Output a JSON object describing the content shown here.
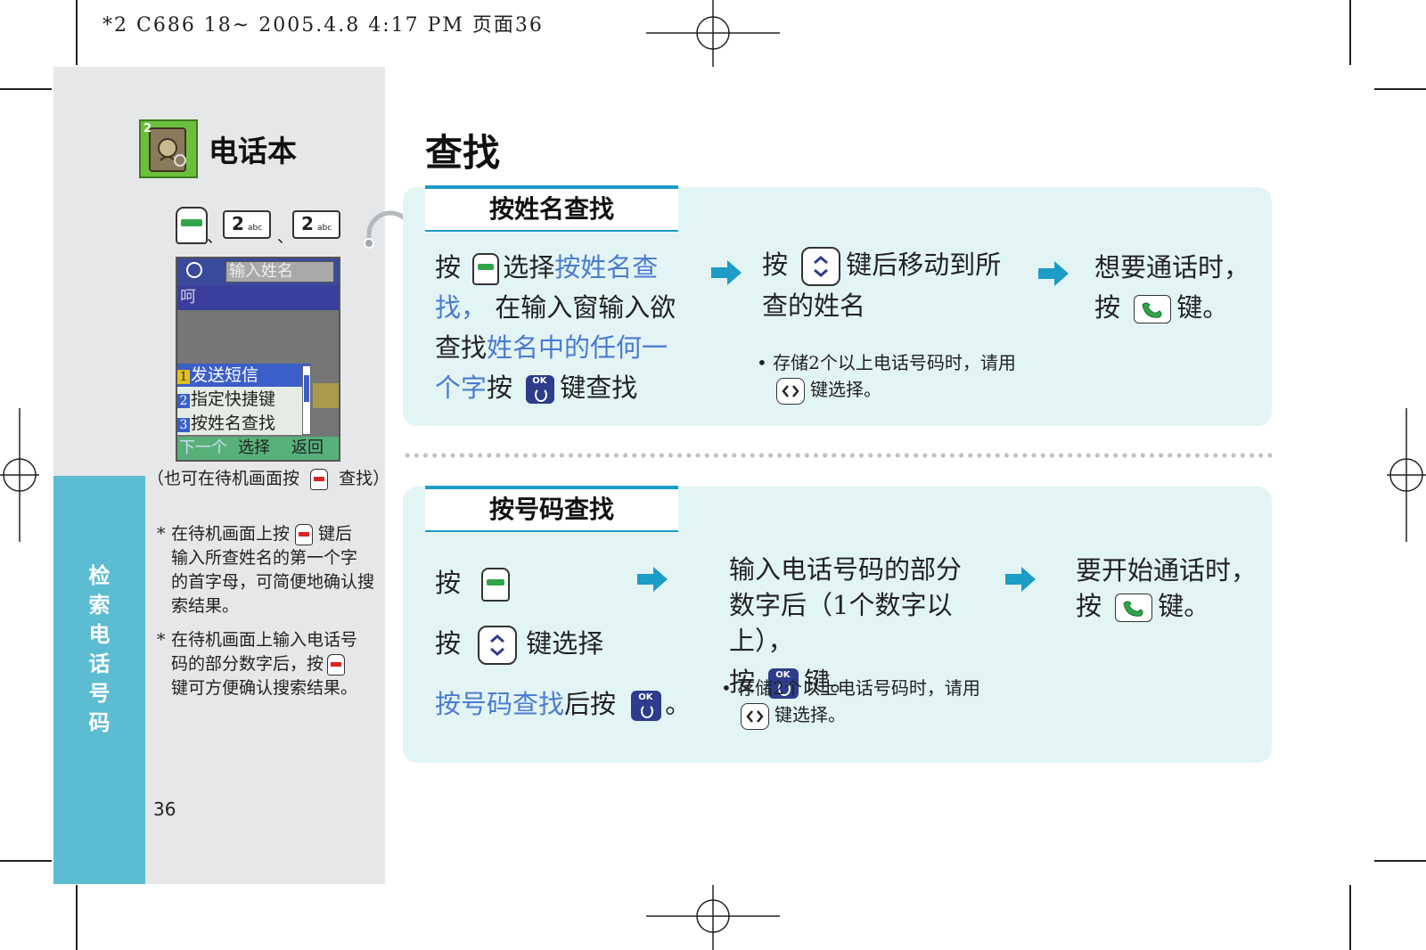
{
  "print_header": "*2 C686 18~ 2005.4.8 4:17 PM 页面36",
  "sidebar": {
    "book_icon_badge": "2",
    "book_title": "电话本",
    "key_sequence": {
      "separator": "、",
      "digit_key": "2",
      "digit_key_sub": "abc"
    },
    "phone_screen": {
      "search_placeholder": "输入姓名",
      "highlight_row": "呵",
      "menu_items": [
        {
          "num": "1",
          "label": "发送短信"
        },
        {
          "num": "2",
          "label": "指定快捷键"
        },
        {
          "num": "3",
          "label": "按姓名查找"
        }
      ],
      "softkeys": {
        "left": "下一个",
        "center": "选择",
        "right": "返回"
      }
    },
    "alt_note_before": "（也可在待机画面按",
    "alt_note_after": "查找）",
    "notes": [
      {
        "mark": "*",
        "line1_before": "在待机画面上按",
        "line1_after": "键后",
        "rest": [
          "输入所查姓名的第一个字",
          "的首字母，可简便地确认搜",
          "索结果。"
        ]
      },
      {
        "mark": "*",
        "lines": [
          "在待机画面上输入电话号"
        ],
        "line2_before": "码的部分数字后，按",
        "line3": "键可方便确认搜索结果。"
      }
    ],
    "vertical_tab": [
      "检",
      "索",
      "电",
      "话",
      "号",
      "码"
    ],
    "page_number": "36"
  },
  "main": {
    "title": "查找",
    "section1": {
      "heading": "按姓名查找",
      "step1": {
        "a": "按",
        "b": "选择",
        "c": "按姓名查",
        "d": "找，",
        "e": "在输入窗输入欲",
        "f": "查找",
        "g": "姓名中的任何一",
        "h": "个字",
        "i": "按",
        "j": "键查找"
      },
      "step2": {
        "a": "按",
        "b": "键后移动到所",
        "c": "查的姓名"
      },
      "step2_note": {
        "bullet": "•",
        "line1": "存储2个以上电话号码时，请用",
        "line2": "键选择。"
      },
      "step3": {
        "line1": "想要通话时，",
        "a": "按",
        "b": "键。"
      }
    },
    "section2": {
      "heading": "按号码查找",
      "step1": {
        "row1": "按",
        "row2_a": "按",
        "row2_b": "键选择",
        "row3_a": "按号码查找",
        "row3_b": "后按",
        "row3_c": "。"
      },
      "step2": {
        "line1": "输入电话号码的部分",
        "line2": "数字后（1个数字以上），",
        "a": "按",
        "b": "键。"
      },
      "step2_note": {
        "bullet": "•",
        "line1": "存储2个以上电话号码时，请用",
        "line2": "键选择。"
      },
      "step3": {
        "line1": "要开始通话时，",
        "a": "按",
        "b": "键。"
      }
    },
    "ok_key_label": "OK"
  },
  "colors": {
    "panel_bg": "#e3f4f5",
    "accent_blue": "#1d9cc7",
    "link_text": "#4a7bd0",
    "tab_bg": "#5bbcd2",
    "left_bg": "#e6e7e8",
    "arrow": "#1d9cc7"
  }
}
